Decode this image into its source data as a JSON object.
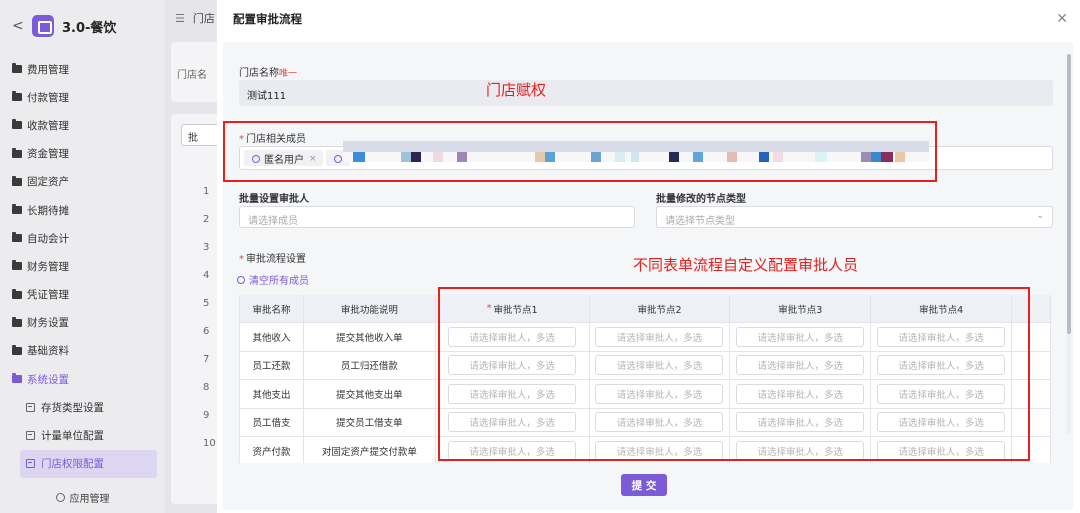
{
  "sidebar": {
    "back_label": "<",
    "app_title": "3.0-餐饮",
    "items": [
      {
        "label": "费用管理"
      },
      {
        "label": "付款管理"
      },
      {
        "label": "收款管理"
      },
      {
        "label": "资金管理"
      },
      {
        "label": "固定资产"
      },
      {
        "label": "长期待摊"
      },
      {
        "label": "自动会计"
      },
      {
        "label": "财务管理"
      },
      {
        "label": "凭证管理"
      },
      {
        "label": "财务设置"
      },
      {
        "label": "基础资料"
      },
      {
        "label": "系统设置"
      }
    ],
    "subitems": [
      {
        "label": "存货类型设置"
      },
      {
        "label": "计量单位配置"
      },
      {
        "label": "门店权限配置"
      }
    ],
    "footer_label": "应用管理"
  },
  "background": {
    "header": "门店",
    "store_name_label": "门店名",
    "batch_button": "批",
    "row_numbers": [
      "1",
      "2",
      "3",
      "4",
      "5",
      "6",
      "7",
      "8",
      "9",
      "10"
    ]
  },
  "modal": {
    "title": "配置审批流程",
    "store_name_label": "门店名称",
    "store_name_tag": "唯一",
    "store_name_value": "测试111",
    "members_label": "门店相关成员",
    "member_chip": "匿名用户",
    "batch_approver_label": "批量设置审批人",
    "batch_approver_placeholder": "请选择成员",
    "node_type_label": "批量修改的节点类型",
    "node_type_placeholder": "请选择节点类型",
    "flow_label": "审批流程设置",
    "clear_label": "清空所有成员",
    "table": {
      "headers": [
        "审批名称",
        "审批功能说明",
        "审批节点1",
        "审批节点2",
        "审批节点3",
        "审批节点4"
      ],
      "cell_placeholder": "请选择审批人，多选",
      "rows": [
        {
          "name": "其他收入",
          "desc": "提交其他收入单"
        },
        {
          "name": "员工还款",
          "desc": "员工归还借款"
        },
        {
          "name": "其他支出",
          "desc": "提交其他支出单"
        },
        {
          "name": "员工借支",
          "desc": "提交员工借支单"
        },
        {
          "name": "资产付款",
          "desc": "对固定资产提交付款单"
        }
      ]
    },
    "submit_label": "提 交"
  },
  "annotations": {
    "store_grant": "门店赋权",
    "custom_approver": "不同表单流程自定义配置审批人员"
  },
  "colors": {
    "accent": "#7b5cd6",
    "annotation": "#e5201e"
  }
}
